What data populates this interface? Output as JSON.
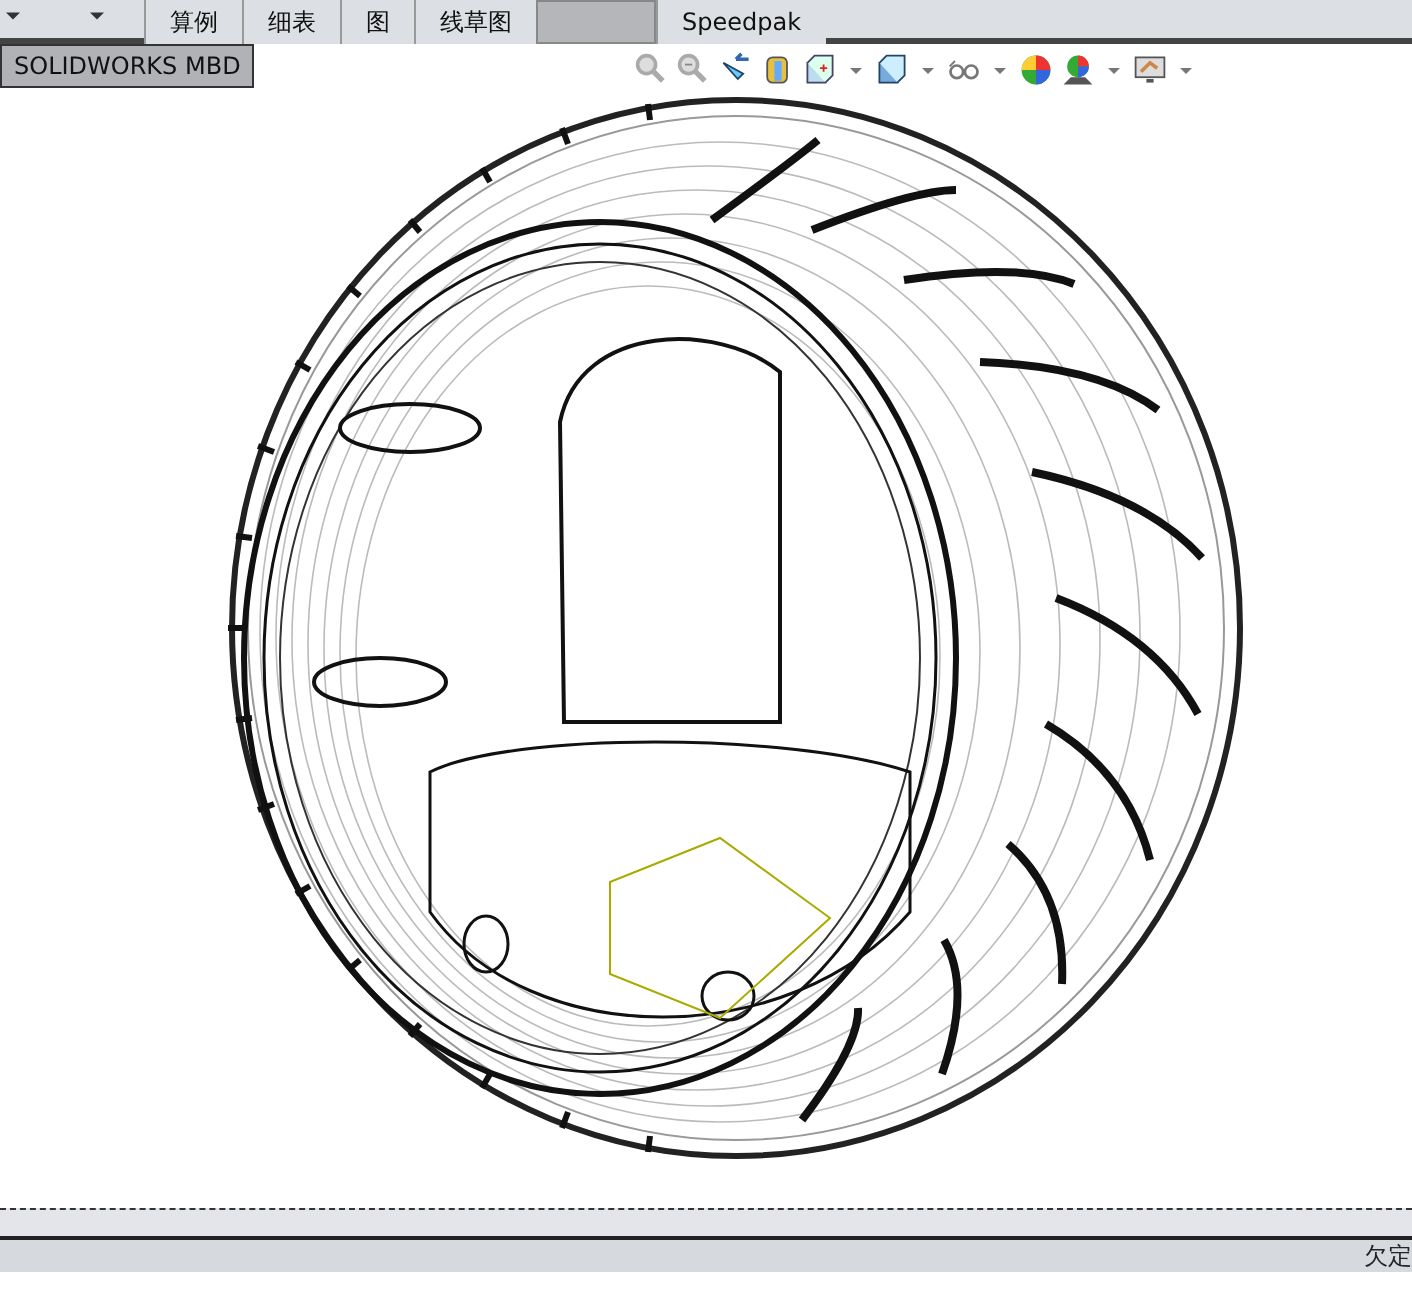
{
  "command_tabs": [
    {
      "kind": "text",
      "label": "算例",
      "selected": false
    },
    {
      "kind": "text",
      "label": "细表",
      "selected": false
    },
    {
      "kind": "text",
      "label": "图",
      "selected": false
    },
    {
      "kind": "text",
      "label": "线草图",
      "selected": false
    },
    {
      "kind": "blank",
      "selected": true
    },
    {
      "kind": "text",
      "label": "Speedpak",
      "selected": false
    }
  ],
  "mbd_tab": {
    "label": "SOLIDWORKS MBD"
  },
  "view_toolbar": [
    {
      "kind": "zoom-fit"
    },
    {
      "kind": "zoom-area"
    },
    {
      "kind": "previous-view"
    },
    {
      "kind": "section-view"
    },
    {
      "kind": "view-orientation"
    },
    {
      "kind": "caret"
    },
    {
      "kind": "display-style"
    },
    {
      "kind": "caret"
    },
    {
      "kind": "hide-show"
    },
    {
      "kind": "caret"
    },
    {
      "kind": "appearance"
    },
    {
      "kind": "scene"
    },
    {
      "kind": "caret"
    },
    {
      "kind": "view-settings"
    },
    {
      "kind": "caret"
    }
  ],
  "status_bar": {
    "text": "欠定"
  }
}
